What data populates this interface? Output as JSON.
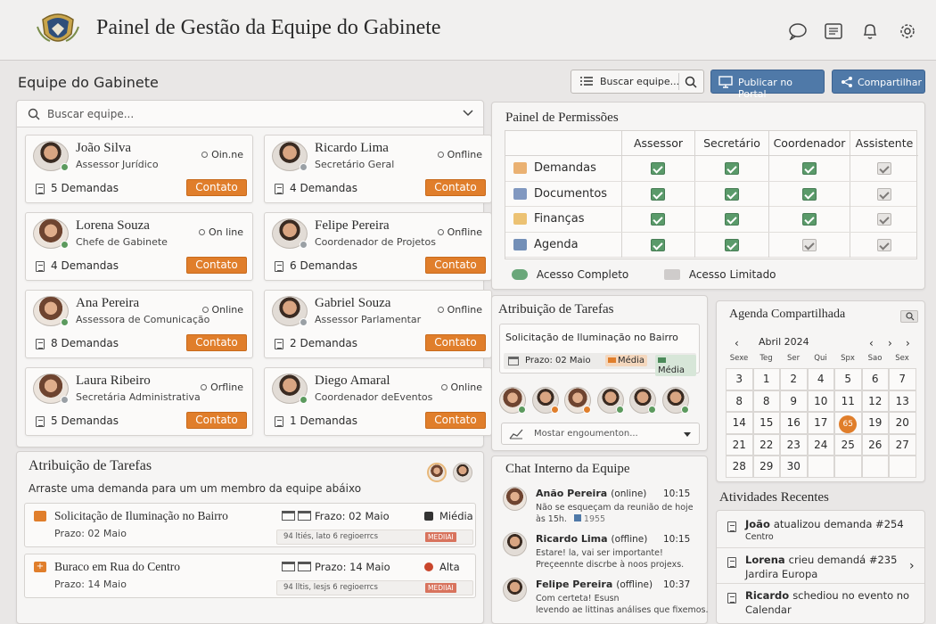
{
  "header": {
    "title": "Painel de Gestão da Equipe do Gabinete"
  },
  "team": {
    "title": "Equipe do Gabinete",
    "search_btn_label": "Buscar equipe...",
    "publish_label": "Publicar no Portal",
    "share_label": "Compartilhar",
    "search_placeholder": "Buscar equipe...",
    "members": [
      {
        "name": "João Silva",
        "role": "Assessor Jurídico",
        "status": "Oin.ne",
        "demands": "5 Demandas",
        "contact": "Contato"
      },
      {
        "name": "Ricardo Lima",
        "role": "Secretário Geral",
        "status": "Onfline",
        "demands": "4 Demandas",
        "contact": "Contato"
      },
      {
        "name": "Lorena Souza",
        "role": "Chefe de Gabinete",
        "status": "On line",
        "demands": "4 Demandas",
        "contact": "Contato"
      },
      {
        "name": "Felipe Pereira",
        "role": "Coordenador de Projetos",
        "status": "Onfline",
        "demands": "6 Demandas",
        "contact": "Contato"
      },
      {
        "name": "Ana Pereira",
        "role": "Assessora de Comunicação",
        "status": "Online",
        "demands": "8 Demandas",
        "contact": "Contato"
      },
      {
        "name": "Gabriel Souza",
        "role": "Assessor Parlamentar",
        "status": "Onfline",
        "demands": "2 Demandas",
        "contact": "Contato"
      },
      {
        "name": "Laura Ribeiro",
        "role": "Secretária Administrativa",
        "status": "Orfline",
        "demands": "5 Demandas",
        "contact": "Contato"
      },
      {
        "name": "Diego Amaral",
        "role": "Coordenador deEventos",
        "status": "Online",
        "demands": "1 Demandas",
        "contact": "Contato"
      }
    ]
  },
  "assign_bottom": {
    "title": "Atribuição de Tarefas",
    "subtitle": "Arraste uma demanda para um um membro da equipe abáixo",
    "tasks": [
      {
        "title": "Solicitação de Iluminação no Bairro",
        "sub": "Prazo: 02 Maio",
        "deadline": "Frazo: 02 Maio",
        "priority": "Miédia",
        "note": "94 ltiés, lato 6 regioerrcs",
        "tag": "MEDIIAI"
      },
      {
        "title": "Buraco em Rua do Centro",
        "sub": "Prazo: 14 Maio",
        "deadline": "Prazo: 14 Maio",
        "priority": "Alta",
        "note": "94 lltis, lesjs 6 regioerrcs",
        "tag": "MEDIIAI"
      }
    ]
  },
  "permissions": {
    "title": "Painel de Permissões",
    "columns": [
      "Assessor",
      "Secretário",
      "Coordenador",
      "Assistente"
    ],
    "rows": [
      {
        "label": "Demandas",
        "cells": [
          "full",
          "full",
          "full",
          "lim"
        ]
      },
      {
        "label": "Documentos",
        "cells": [
          "full",
          "full",
          "full",
          "lim"
        ]
      },
      {
        "label": "Finanças",
        "cells": [
          "full",
          "full",
          "full",
          "lim"
        ]
      },
      {
        "label": "Agenda",
        "cells": [
          "full",
          "full",
          "lim",
          "lim"
        ]
      }
    ],
    "legend_full": "Acesso Completo",
    "legend_limited": "Acesso Limitado"
  },
  "assign_mid": {
    "title": "Atribuição de Tarefas",
    "task_title": "Solicitação de Iluminação no Bairro",
    "deadline": "Prazo: 02 Maio",
    "tag1": "Média",
    "tag2": "Média",
    "dropdown": "Mostar engoumenton..."
  },
  "chat": {
    "title": "Chat Interno da Equipe",
    "messages": [
      {
        "name": "Anão Pereira",
        "status": "(online)",
        "time": "10:15",
        "text1": "Não se esqueçam da reunião de hoje",
        "text2": "às 15h.",
        "extra": "1955"
      },
      {
        "name": "Ricardo Lima",
        "status": "(offline)",
        "time": "10:15",
        "text1": "Estare! la, vai ser importante!",
        "text2": "Preçeennte discrbe à noos projexs."
      },
      {
        "name": "Felipe Pereira",
        "status": "(offline)",
        "time": "10:37",
        "text1": "Com certeta! Esusn",
        "text2": "levendo ae littinas análises que fixemos."
      }
    ]
  },
  "calendar": {
    "title": "Agenda Compartilhada",
    "month": "Abril 2024",
    "weekdays": [
      "Sexe",
      "Teg",
      "Ser",
      "Qui",
      "Spx",
      "Sao",
      "Sex"
    ],
    "weeks": [
      [
        "3",
        "1",
        "2",
        "4",
        "5",
        "6",
        "7"
      ],
      [
        "8",
        "8",
        "9",
        "10",
        "11",
        "12",
        "13"
      ],
      [
        "14",
        "15",
        "16",
        "17",
        "18",
        "19",
        "20"
      ],
      [
        "21",
        "22",
        "23",
        "24",
        "25",
        "26",
        "27"
      ],
      [
        "28",
        "29",
        "30",
        "",
        "",
        "",
        ""
      ]
    ],
    "highlight": "65"
  },
  "activity": {
    "title": "Atividades Recentes",
    "items": [
      {
        "who": "João",
        "text": "atualizou demanda #254",
        "sub": "Centro"
      },
      {
        "who": "Lorena",
        "text": "crieu demandá #235",
        "sub": "Jardira Europa"
      },
      {
        "who": "Ricardo",
        "text": "schediou no evento no",
        "sub": "Calendar"
      }
    ]
  }
}
